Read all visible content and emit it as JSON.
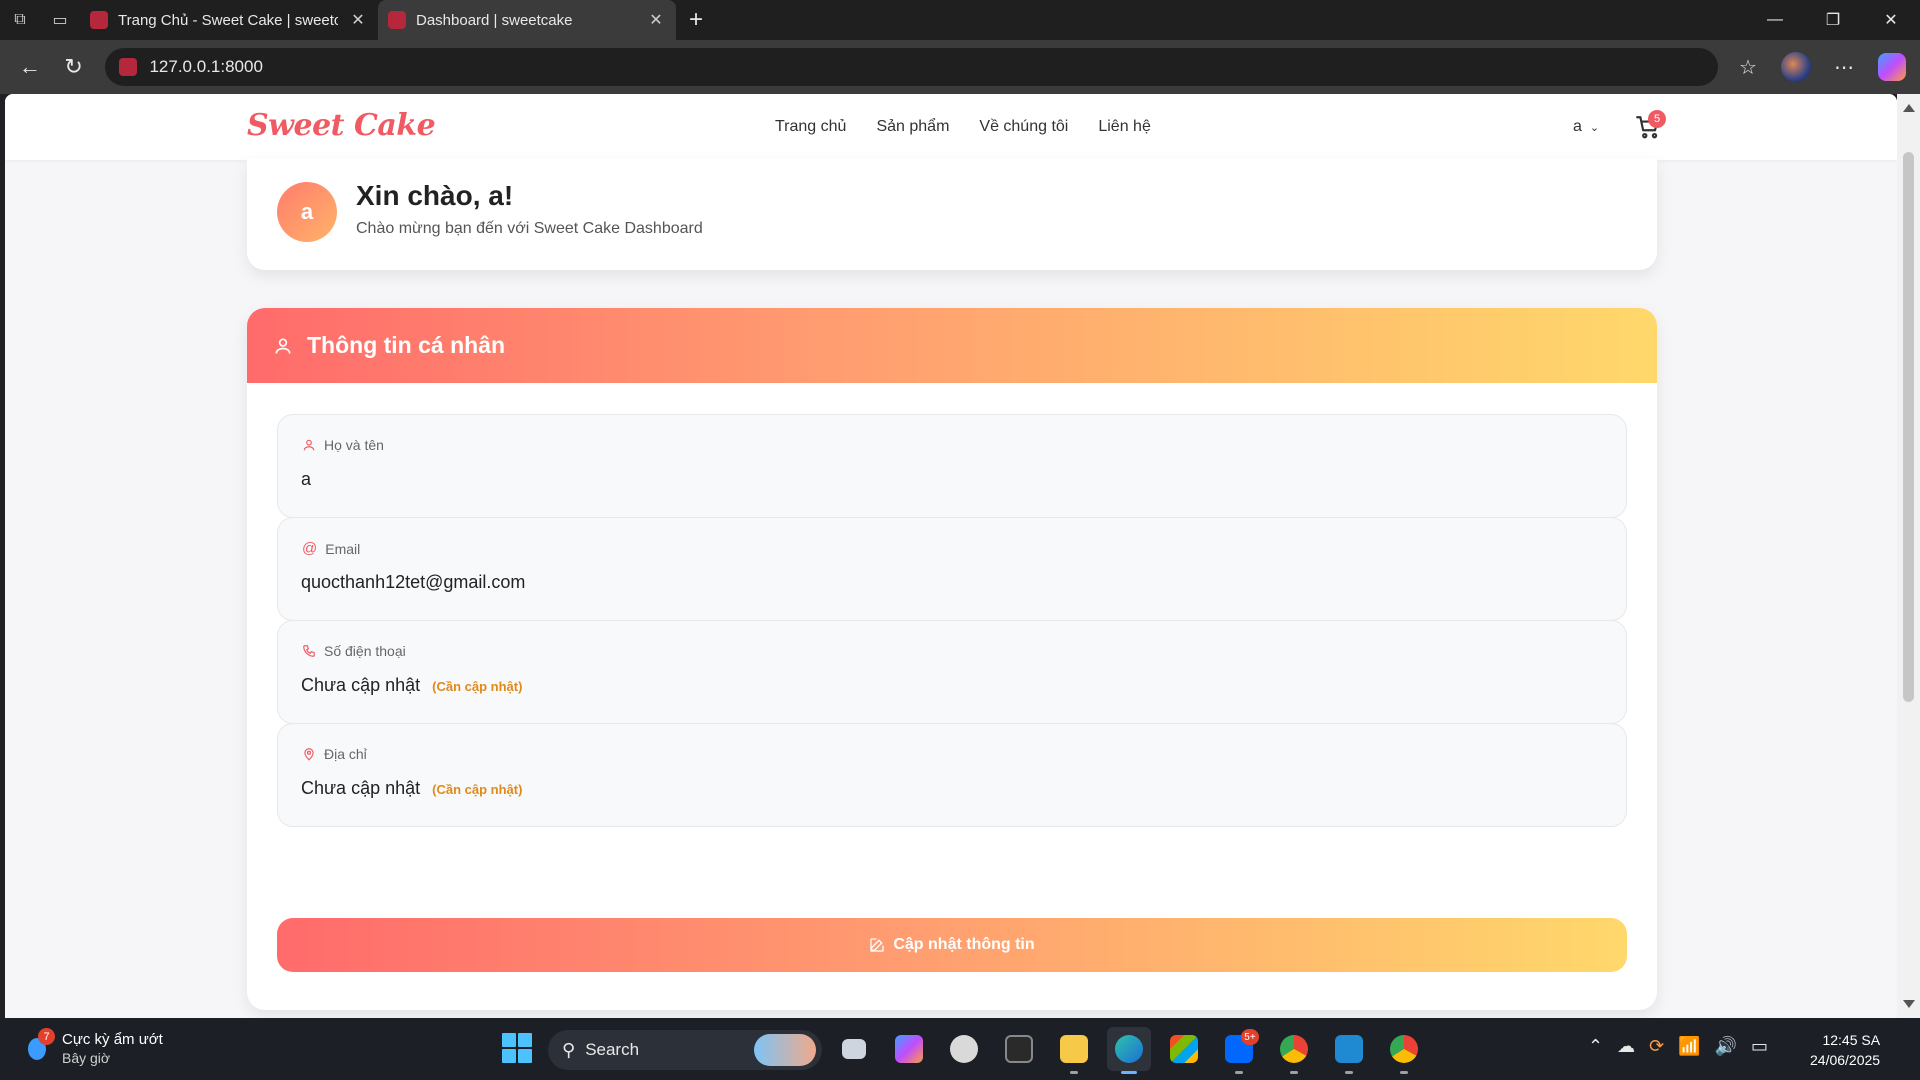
{
  "browser": {
    "tabs": [
      {
        "title": "Trang Chủ - Sweet Cake | sweetca",
        "active": false
      },
      {
        "title": "Dashboard | sweetcake",
        "active": true
      }
    ],
    "url": "127.0.0.1:8000"
  },
  "site": {
    "logo": "Sweet Cake",
    "nav": [
      "Trang chủ",
      "Sản phẩm",
      "Về chúng tôi",
      "Liên hệ"
    ],
    "user_label": "a",
    "cart_count": "5"
  },
  "welcome": {
    "avatar_letter": "a",
    "title": "Xin chào, a!",
    "subtitle": "Chào mừng bạn đến với Sweet Cake Dashboard"
  },
  "profile": {
    "heading": "Thông tin cá nhân",
    "fields": [
      {
        "label": "Họ và tên",
        "value": "a",
        "hint": ""
      },
      {
        "label": "Email",
        "value": "quocthanh12tet@gmail.com",
        "hint": ""
      },
      {
        "label": "Số điện thoại",
        "value": "Chưa cập nhật",
        "hint": "(Cần cập nhật)"
      },
      {
        "label": "Địa chỉ",
        "value": "Chưa cập nhật",
        "hint": "(Cần cập nhật)"
      }
    ],
    "update_button": "Cập nhật thông tin"
  },
  "taskbar": {
    "weather_badge": "7",
    "weather_title": "Cực kỳ ẩm ướt",
    "weather_sub": "Bây giờ",
    "search_label": "Search",
    "zalo_badge": "5+",
    "time": "12:45 SA",
    "date": "24/06/2025"
  },
  "colors": {
    "brand": "#f05a62",
    "gradient_start": "#ff6b6b",
    "gradient_end": "#ffd86b",
    "hint": "#e08a1a"
  }
}
